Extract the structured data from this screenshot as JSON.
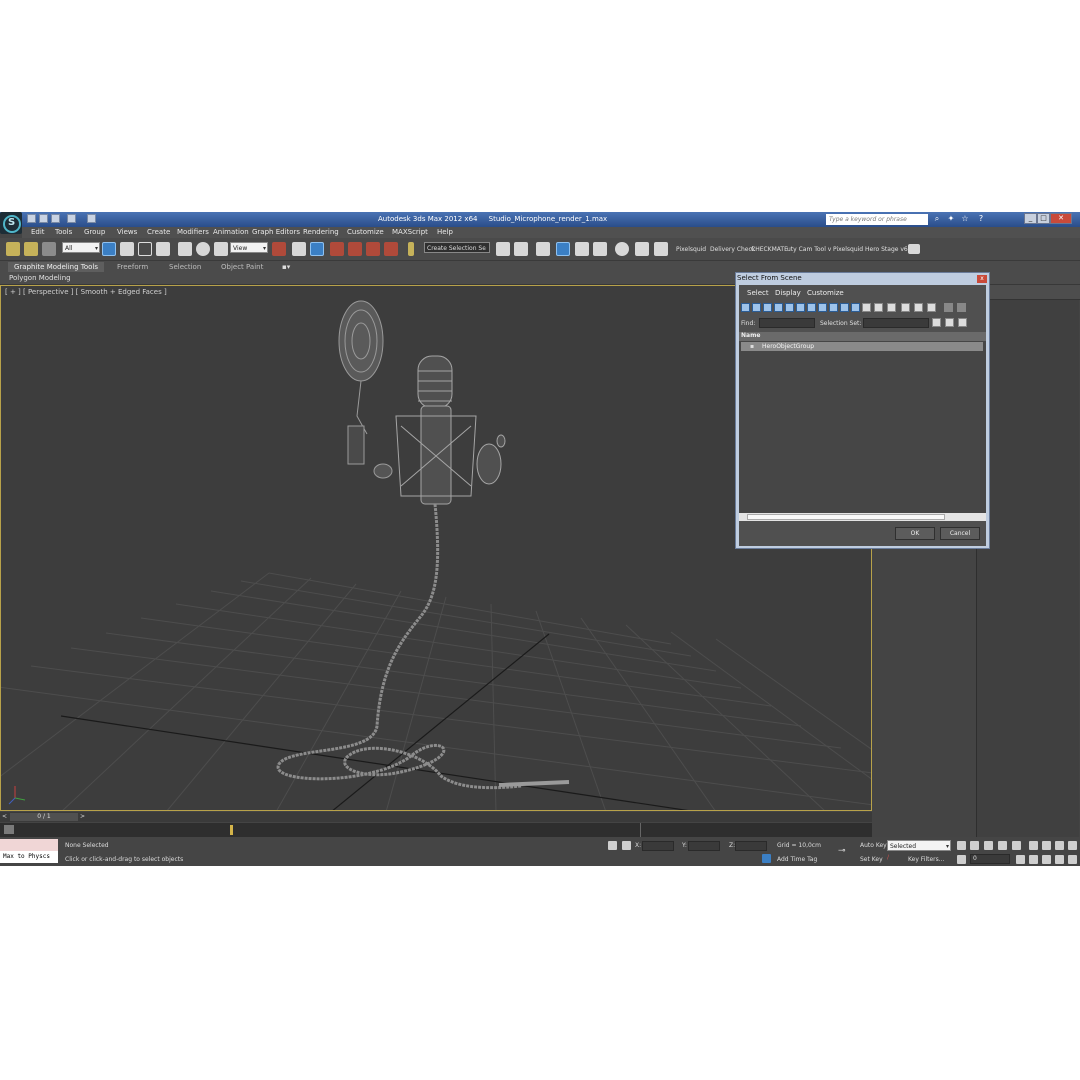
{
  "app": {
    "title": "Autodesk 3ds Max  2012 x64",
    "file": "Studio_Microphone_render_1.max",
    "search_placeholder": "Type a keyword or phrase"
  },
  "menu": [
    "Edit",
    "Tools",
    "Group",
    "Views",
    "Create",
    "Modifiers",
    "Animation",
    "Graph Editors",
    "Rendering",
    "Customize",
    "MAXScript",
    "Help"
  ],
  "toolbar": {
    "filter_value": "All",
    "ref_coord_value": "View",
    "selection_set_value": "Create Selection Se",
    "plugins": [
      "Pixelsquid",
      "Delivery Check",
      "CHECKMATE",
      "uty Cam Tool v",
      "Pixelsquid",
      "Hero Stage v6"
    ]
  },
  "ribbon": {
    "tabs": [
      "Graphite Modeling Tools",
      "Freeform",
      "Selection",
      "Object Paint"
    ],
    "panel_label": "Polygon Modeling"
  },
  "viewport": {
    "label": "[ + ] [ Perspective ] [ Smooth + Edged Faces ]"
  },
  "dialog": {
    "title": "Select From Scene",
    "menu": [
      "Select",
      "Display",
      "Customize"
    ],
    "find_label": "Find:",
    "selection_set_label": "Selection Set:",
    "column_name": "Name",
    "items": [
      "HeroObjectGroup"
    ],
    "ok_label": "OK",
    "cancel_label": "Cancel"
  },
  "timeline": {
    "frame_counter": "0 / 1"
  },
  "status": {
    "script_box": "Max to Physcs",
    "selection": "None Selected",
    "prompt": "Click or click-and-drag to select objects",
    "x_label": "X:",
    "y_label": "Y:",
    "z_label": "Z:",
    "grid": "Grid = 10,0cm",
    "add_time_tag": "Add Time Tag",
    "auto_key": "Auto Key",
    "selected_value": "Selected",
    "set_key": "Set Key",
    "key_filters": "Key Filters...",
    "frame_value": "0"
  }
}
